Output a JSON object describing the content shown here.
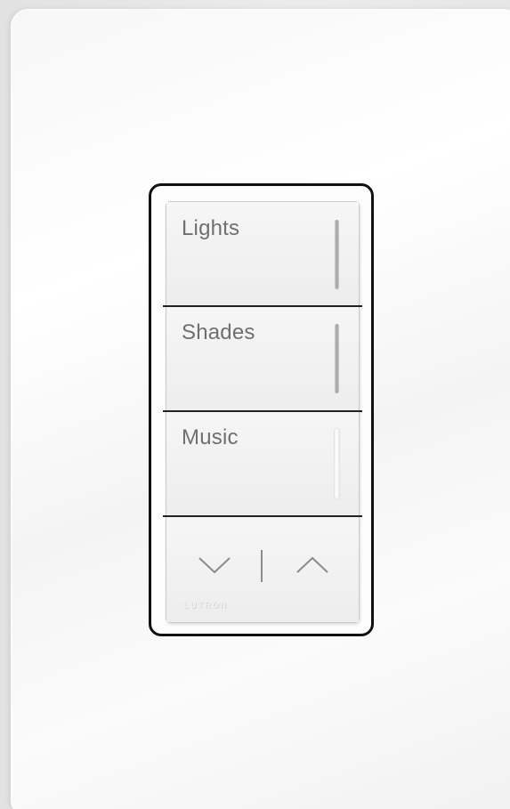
{
  "keypad": {
    "buttons": [
      {
        "label": "Lights",
        "led": "on"
      },
      {
        "label": "Shades",
        "led": "on"
      },
      {
        "label": "Music",
        "led": "off"
      }
    ],
    "raise_lower": {
      "lower_icon": "chevron-down-icon",
      "raise_icon": "chevron-up-icon"
    },
    "brand": "LUTRON"
  }
}
